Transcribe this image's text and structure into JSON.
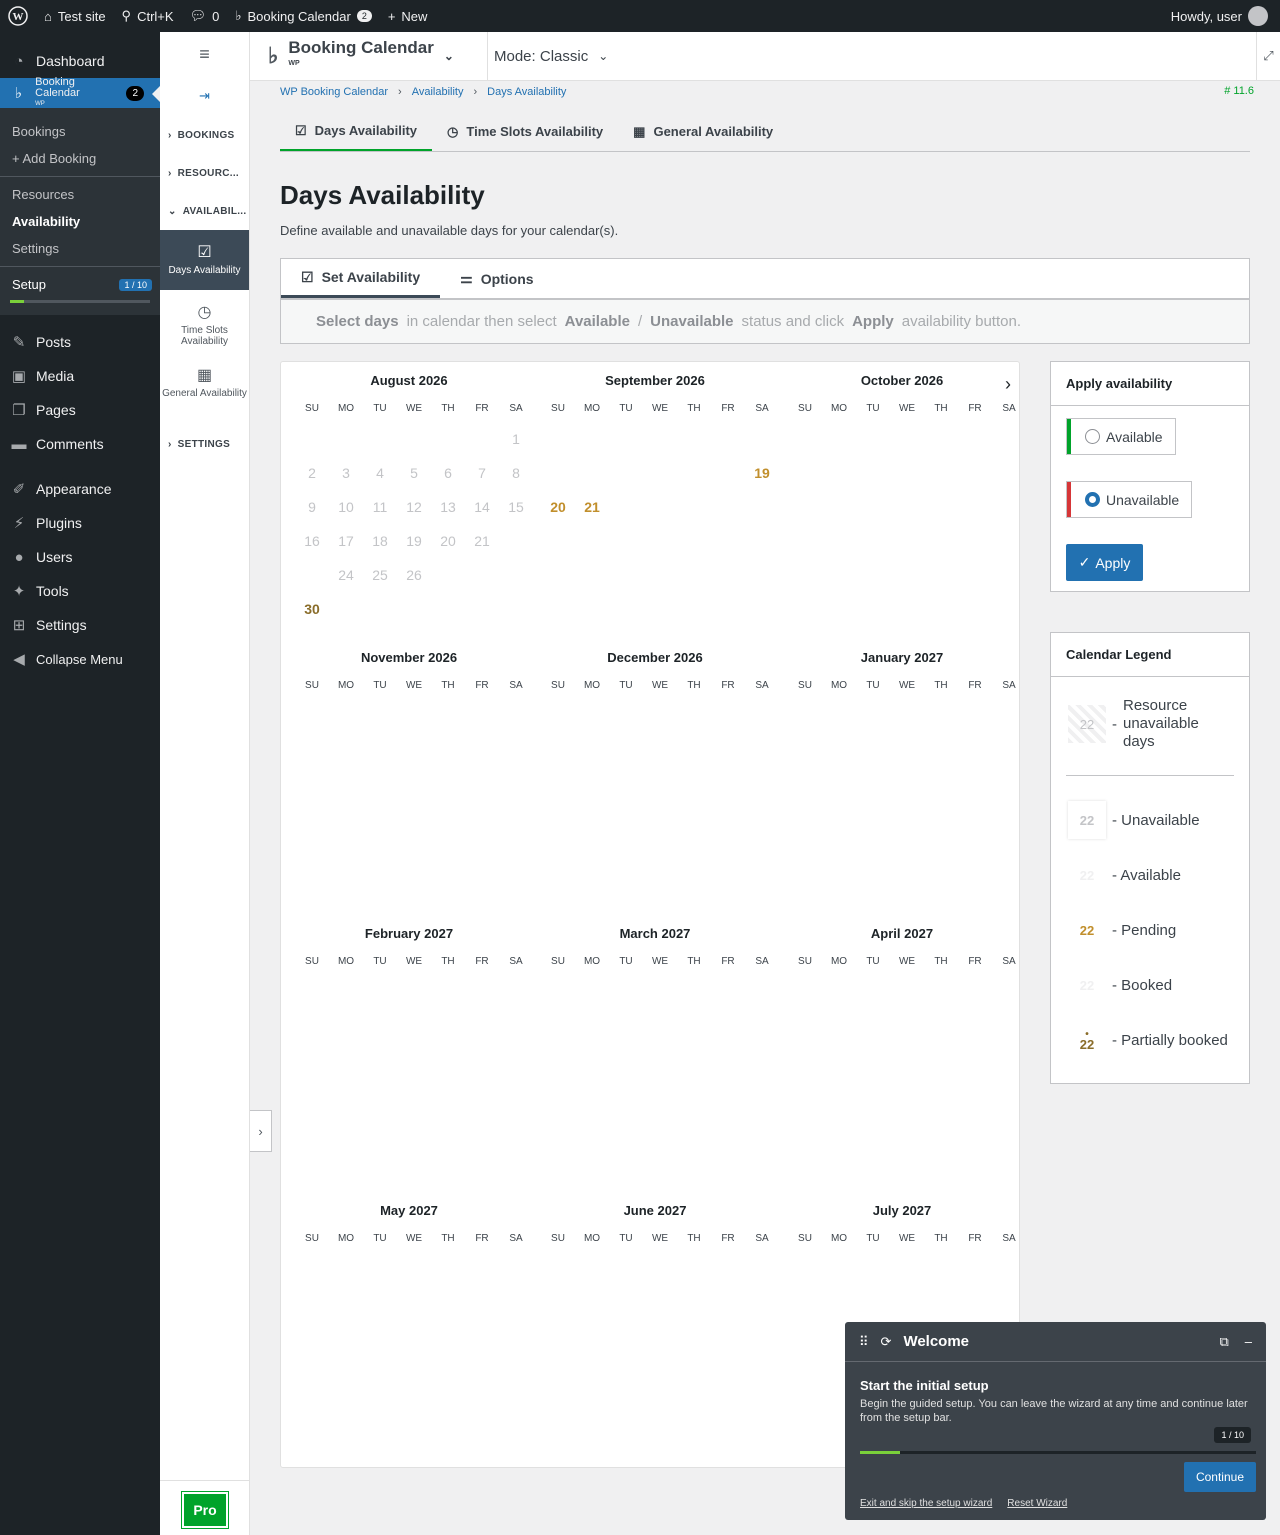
{
  "adminbar": {
    "site": "Test site",
    "search": "Ctrl+K",
    "comments": "0",
    "plugin": "Booking Calendar",
    "plugin_count": "2",
    "new": "New",
    "howdy": "Howdy, user"
  },
  "adminmenu": {
    "dashboard": "Dashboard",
    "booking": "Booking Calendar",
    "booking_sub": "WP",
    "booking_count": "2",
    "sub": [
      "Bookings",
      "+ Add Booking",
      "Resources",
      "Availability",
      "Settings"
    ],
    "setup": "Setup",
    "setup_count": "1 / 10",
    "items": [
      "Posts",
      "Media",
      "Pages",
      "Comments",
      "Appearance",
      "Plugins",
      "Users",
      "Tools",
      "Settings",
      "Collapse Menu"
    ]
  },
  "bcnav": {
    "bookings": "BOOKINGS",
    "resources": "RESOURC...",
    "availability": "AVAILABIL...",
    "days": "Days Availability",
    "timeslots": "Time Slots Availability",
    "general": "General Availability",
    "settings": "SETTINGS",
    "pro": "Pro"
  },
  "top": {
    "brand": "Booking Calendar",
    "brand_sub": "WP",
    "mode": "Mode: Classic"
  },
  "crumbs": [
    "WP Booking Calendar",
    "Availability",
    "Days Availability"
  ],
  "version": "# 11.6",
  "tabs": [
    "Days Availability",
    "Time Slots Availability",
    "General Availability"
  ],
  "page": {
    "title": "Days Availability",
    "desc": "Define available and unavailable days for your calendar(s)."
  },
  "subtabs": [
    "Set Availability",
    "Options"
  ],
  "hint": {
    "a": "Select days",
    "b": "in calendar then select",
    "c": "Available",
    "d": "/",
    "e": "Unavailable",
    "f": "status and click",
    "g": "Apply",
    "h": "availability button."
  },
  "weekdays": [
    "SU",
    "MO",
    "TU",
    "WE",
    "TH",
    "FR",
    "SA"
  ],
  "months": [
    "August 2026",
    "September 2026",
    "October 2026",
    "November 2026",
    "December 2026",
    "January 2027",
    "February 2027",
    "March 2027",
    "April 2027",
    "May 2027",
    "June 2027",
    "July 2027"
  ],
  "august_days": [
    "",
    "",
    "",
    "",
    "",
    "",
    "1",
    "2",
    "3",
    "4",
    "5",
    "6",
    "7",
    "8",
    "9",
    "10",
    "11",
    "12",
    "13",
    "14",
    "15",
    "16",
    "17",
    "18",
    "19",
    "20",
    "21",
    "",
    "",
    "24",
    "25",
    "26",
    "",
    "",
    "",
    "30"
  ],
  "august_pending": "30",
  "september_row": [
    "",
    "",
    "",
    "",
    "",
    "",
    "19"
  ],
  "september_row2": [
    "20",
    "21",
    "",
    "",
    "",
    "",
    ""
  ],
  "apply": {
    "title": "Apply availability",
    "available": "Available",
    "unavailable": "Unavailable",
    "button": "Apply",
    "selected": "unavailable"
  },
  "legend": {
    "title": "Calendar Legend",
    "cell": "22",
    "resource": "Resource unavailable days",
    "unavailable": "- Unavailable",
    "available": "- Available",
    "pending": "- Pending",
    "booked": "- Booked",
    "partial": "- Partially booked"
  },
  "welcome": {
    "title": "Welcome",
    "heading": "Start the initial setup",
    "desc": "Begin the guided setup. You can leave the wizard at any time and continue later from the setup bar.",
    "step": "1 / 10",
    "progress": 0.1,
    "continue": "Continue",
    "exit": "Exit and skip the setup wizard",
    "reset": "Reset Wizard"
  }
}
